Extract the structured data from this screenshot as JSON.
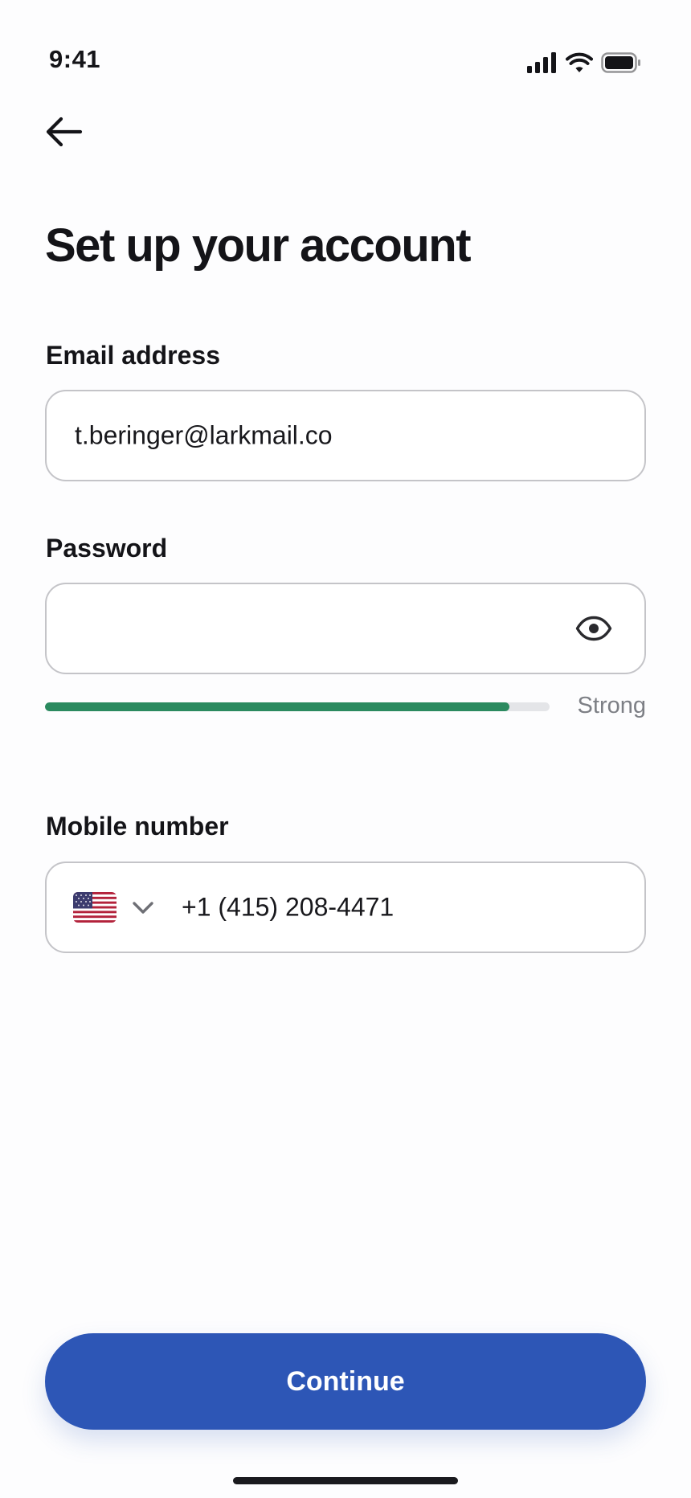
{
  "status_bar": {
    "time": "9:41",
    "icons": [
      "cellular-signal-icon",
      "wifi-icon",
      "battery-icon"
    ]
  },
  "nav": {
    "back_icon": "arrow-left-icon"
  },
  "page": {
    "title": "Set up your account"
  },
  "form": {
    "email": {
      "label": "Email address",
      "value": "t.beringer@larkmail.co"
    },
    "password": {
      "label": "Password",
      "value": "",
      "visibility_icon": "eye-icon",
      "strength_label": "Strong",
      "strength_fraction": 0.92,
      "strength_color": "#2b8a5f"
    },
    "mobile": {
      "label": "Mobile number",
      "country_flag": "us-flag-icon",
      "country_icon": "chevron-down-icon",
      "value": "+1 (415) 208-4471"
    }
  },
  "actions": {
    "continue_label": "Continue",
    "continue_color": "#2d56b6"
  }
}
